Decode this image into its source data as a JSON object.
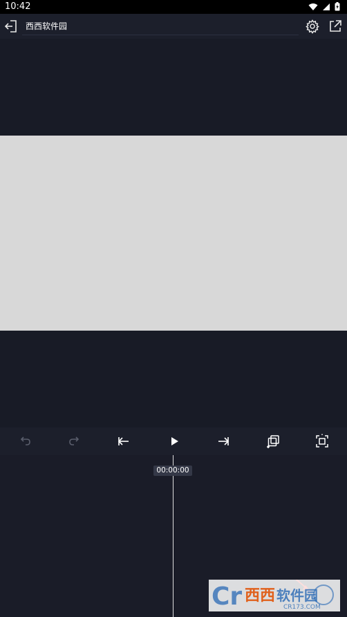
{
  "status_bar": {
    "time": "10:42",
    "icons": [
      "wifi-icon",
      "cellular-icon",
      "battery-icon"
    ]
  },
  "top_bar": {
    "title": "西西软件园",
    "icons": [
      "exit-icon",
      "gear-icon",
      "share-external-icon"
    ]
  },
  "toolbar": {
    "tools": [
      "undo-icon",
      "redo-icon",
      "skip-to-start-icon",
      "play-icon",
      "skip-to-end-icon",
      "duplicate-layer-icon",
      "fit-screen-icon"
    ]
  },
  "timeline": {
    "current_time": "00:00:00"
  },
  "watermark": {
    "text": "西西软件园",
    "subtext": "CR173.COM"
  },
  "colors": {
    "background": "#181b26",
    "canvas": "#d8d8d8",
    "toolbar": "#1c1f2b",
    "timeline": "#1a1c28",
    "accent_red": "#e0241b"
  }
}
